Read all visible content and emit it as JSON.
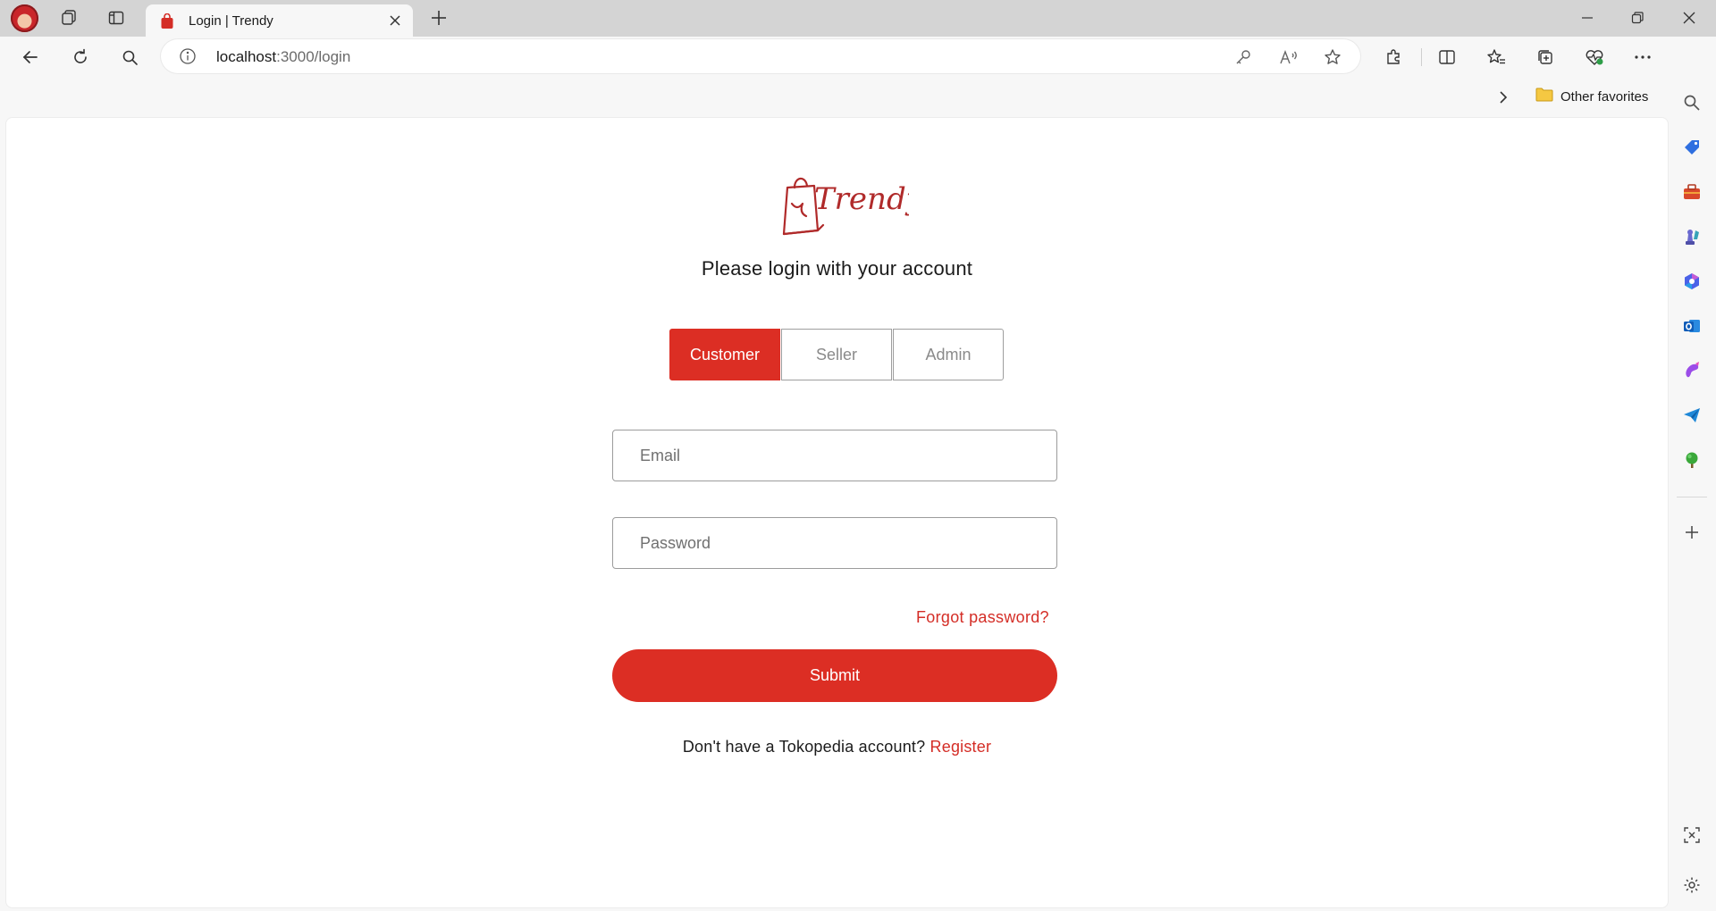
{
  "browser": {
    "tab": {
      "title": "Login | Trendy"
    },
    "address_bar": {
      "host": "localhost",
      "path": ":3000/login"
    },
    "favorites_bar": {
      "folder_label": "Other favorites"
    }
  },
  "page": {
    "logo_text": "Trendy",
    "heading": "Please login with your account",
    "roles": [
      {
        "label": "Customer",
        "selected": true
      },
      {
        "label": "Seller",
        "selected": false
      },
      {
        "label": "Admin",
        "selected": false
      }
    ],
    "email": {
      "placeholder": "Email",
      "value": ""
    },
    "password": {
      "placeholder": "Password",
      "value": ""
    },
    "forgot_password": "Forgot password?",
    "submit_label": "Submit",
    "register_prompt": "Don't have a Tokopedia account?",
    "register_link": "Register"
  },
  "colors": {
    "brand_red": "#dc2e24",
    "link_red": "#d42d26"
  }
}
